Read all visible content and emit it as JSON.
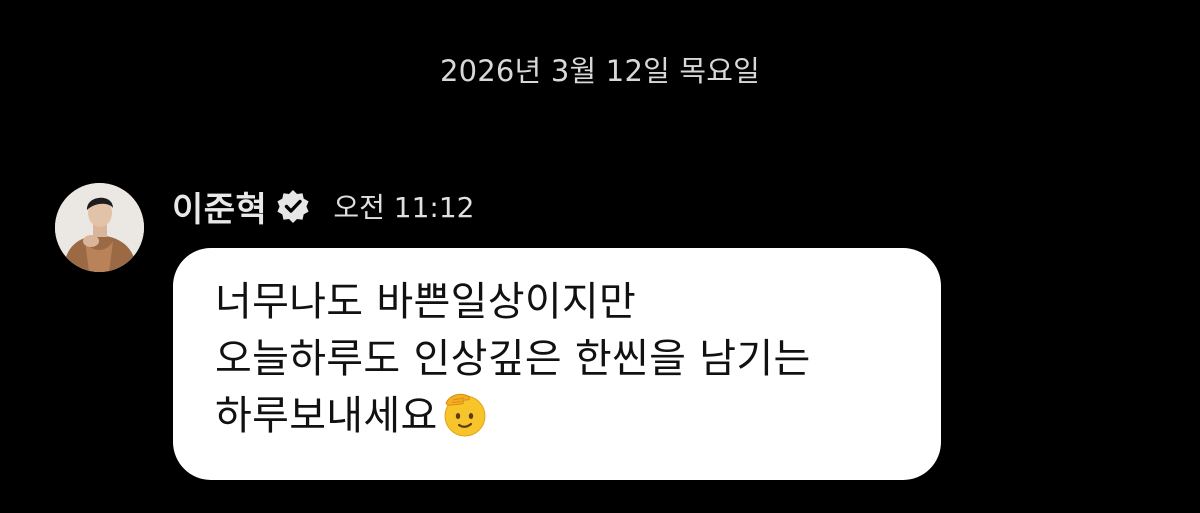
{
  "chat": {
    "date_divider": "2026년 3월 12일 목요일",
    "message": {
      "sender_name": "이준혁",
      "verified": true,
      "time": "오전 11:12",
      "lines": [
        "너무나도 바쁜일상이지만",
        "오늘하루도 인상깊은 한씬을 남기는",
        "하루보내세요"
      ],
      "trailing_emoji": "saluting-face-emoji"
    }
  },
  "colors": {
    "background": "#000000",
    "bubble": "#ffffff",
    "bubble_text": "#111111",
    "meta_text": "#d8d8d8",
    "emoji_yellow": "#f7c52b"
  },
  "icons": {
    "verified": "verified-badge-icon",
    "avatar": "profile-photo"
  }
}
